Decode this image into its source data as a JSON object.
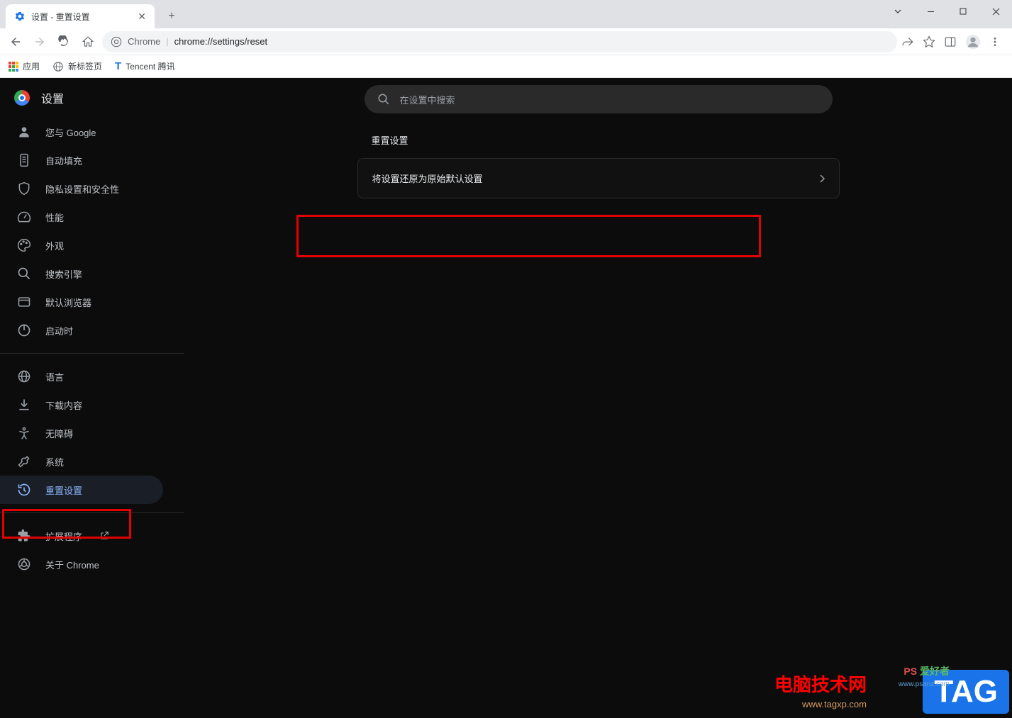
{
  "window": {
    "tab_title": "设置 - 重置设置"
  },
  "toolbar": {
    "chrome_label": "Chrome",
    "url": "chrome://settings/reset"
  },
  "bookmarks": {
    "apps": "应用",
    "newtab": "新标签页",
    "tencent": "Tencent 腾讯"
  },
  "sidebar": {
    "title": "设置",
    "items": [
      {
        "label": "您与 Google",
        "icon": "person"
      },
      {
        "label": "自动填充",
        "icon": "autofill"
      },
      {
        "label": "隐私设置和安全性",
        "icon": "shield"
      },
      {
        "label": "性能",
        "icon": "speed"
      },
      {
        "label": "外观",
        "icon": "palette"
      },
      {
        "label": "搜索引擎",
        "icon": "search"
      },
      {
        "label": "默认浏览器",
        "icon": "browser"
      },
      {
        "label": "启动时",
        "icon": "power"
      }
    ],
    "items2": [
      {
        "label": "语言",
        "icon": "globe"
      },
      {
        "label": "下载内容",
        "icon": "download"
      },
      {
        "label": "无障碍",
        "icon": "accessibility"
      },
      {
        "label": "系统",
        "icon": "wrench"
      },
      {
        "label": "重置设置",
        "icon": "history",
        "active": true
      }
    ],
    "items3": [
      {
        "label": "扩展程序",
        "icon": "extension",
        "external": true
      },
      {
        "label": "关于 Chrome",
        "icon": "chrome"
      }
    ]
  },
  "main": {
    "search_placeholder": "在设置中搜索",
    "section_title": "重置设置",
    "reset_row": "将设置还原为原始默认设置"
  },
  "watermarks": {
    "red_main": "电脑技术网",
    "red_sub": "www.tagxp.com",
    "tag": "TAG",
    "ps": "PS 爱好者",
    "ps_sub": "www.psanz.com"
  }
}
